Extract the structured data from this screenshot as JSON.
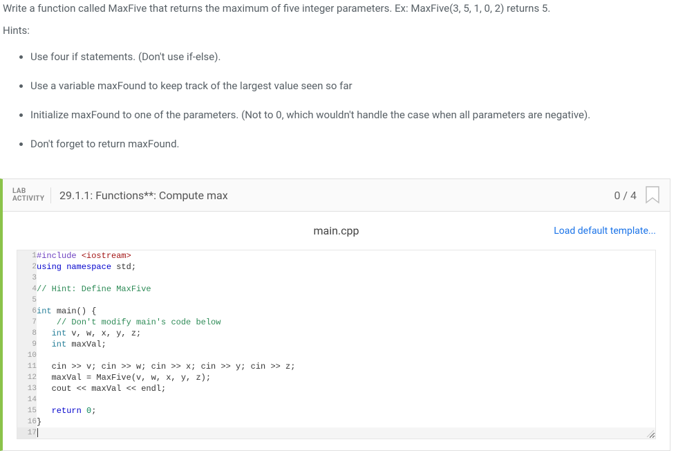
{
  "instructions": {
    "prompt": "Write a function called MaxFive that returns the maximum of five integer parameters. Ex: MaxFive(3, 5, 1, 0, 2) returns 5.",
    "hints_label": "Hints:",
    "hints": [
      "Use four if statements. (Don't use if-else).",
      "Use a variable maxFound to keep track of the largest value seen so far",
      "Initialize maxFound to one of the parameters. (Not to 0, which wouldn't handle the case when all parameters are negative).",
      "Don't forget to return maxFound."
    ]
  },
  "lab": {
    "activity_label_line1": "LAB",
    "activity_label_line2": "ACTIVITY",
    "title": "29.1.1: Functions**: Compute max",
    "score": "0 / 4"
  },
  "editor": {
    "file_name": "main.cpp",
    "load_template_label": "Load default template...",
    "lines": [
      {
        "n": 1,
        "tokens": [
          {
            "t": "#include ",
            "c": "tok-pre"
          },
          {
            "t": "<iostream>",
            "c": "tok-str"
          }
        ]
      },
      {
        "n": 2,
        "tokens": [
          {
            "t": "using ",
            "c": "tok-kw"
          },
          {
            "t": "namespace ",
            "c": "tok-kw"
          },
          {
            "t": "std;",
            "c": ""
          }
        ]
      },
      {
        "n": 3,
        "tokens": [
          {
            "t": "",
            "c": ""
          }
        ]
      },
      {
        "n": 4,
        "tokens": [
          {
            "t": "// Hint: Define MaxFive",
            "c": "tok-cmt"
          }
        ]
      },
      {
        "n": 5,
        "tokens": [
          {
            "t": "",
            "c": ""
          }
        ]
      },
      {
        "n": 6,
        "tokens": [
          {
            "t": "int ",
            "c": "tok-type"
          },
          {
            "t": "main() {",
            "c": ""
          }
        ]
      },
      {
        "n": 7,
        "tokens": [
          {
            "t": "    ",
            "c": ""
          },
          {
            "t": "// Don't modify main's code below",
            "c": "tok-cmt"
          }
        ]
      },
      {
        "n": 8,
        "tokens": [
          {
            "t": "   ",
            "c": ""
          },
          {
            "t": "int ",
            "c": "tok-type"
          },
          {
            "t": "v, w, x, y, z;",
            "c": ""
          }
        ]
      },
      {
        "n": 9,
        "tokens": [
          {
            "t": "   ",
            "c": ""
          },
          {
            "t": "int ",
            "c": "tok-type"
          },
          {
            "t": "maxVal;",
            "c": ""
          }
        ]
      },
      {
        "n": 10,
        "tokens": [
          {
            "t": "",
            "c": ""
          }
        ]
      },
      {
        "n": 11,
        "tokens": [
          {
            "t": "   cin >> v; cin >> w; cin >> x; cin >> y; cin >> z;",
            "c": ""
          }
        ]
      },
      {
        "n": 12,
        "tokens": [
          {
            "t": "   maxVal = MaxFive(v, w, x, y, z);",
            "c": ""
          }
        ]
      },
      {
        "n": 13,
        "tokens": [
          {
            "t": "   cout << maxVal << endl;",
            "c": ""
          }
        ]
      },
      {
        "n": 14,
        "tokens": [
          {
            "t": "",
            "c": ""
          }
        ]
      },
      {
        "n": 15,
        "tokens": [
          {
            "t": "   ",
            "c": ""
          },
          {
            "t": "return ",
            "c": "tok-kw"
          },
          {
            "t": "0",
            "c": "tok-num"
          },
          {
            "t": ";",
            "c": ""
          }
        ]
      },
      {
        "n": 16,
        "tokens": [
          {
            "t": "}",
            "c": ""
          }
        ]
      },
      {
        "n": 17,
        "tokens": [
          {
            "t": "",
            "c": ""
          }
        ],
        "active": true
      }
    ]
  }
}
